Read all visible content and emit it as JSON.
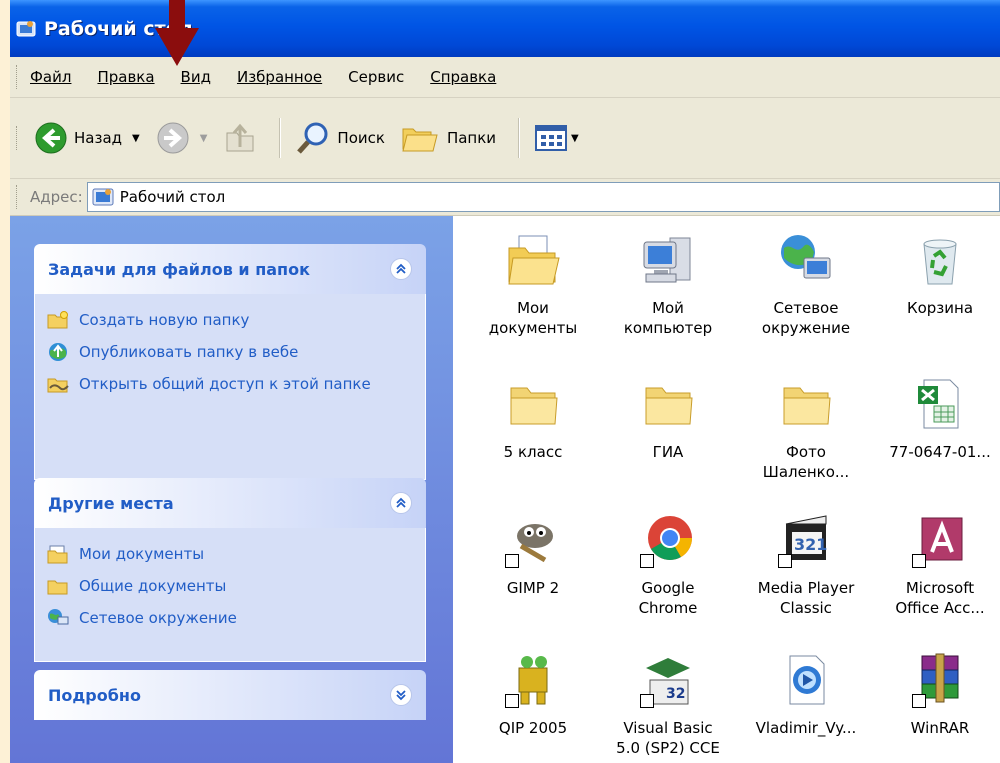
{
  "window": {
    "title": "Рабочий стол",
    "colors": {
      "titlebar": "#0055e5",
      "taskpane": "#6375d6",
      "link": "#215dc6",
      "desktop_bg": "#fdf1d6"
    }
  },
  "menu": [
    "Файл",
    "Правка",
    "Вид",
    "Избранное",
    "Сервис",
    "Справка"
  ],
  "menu_underline_index": [
    0,
    0,
    0,
    0,
    1,
    0
  ],
  "toolbar": {
    "back_label": "Назад",
    "search_label": "Поиск",
    "folders_label": "Папки",
    "icons": [
      "back-arrow-icon",
      "forward-arrow-icon",
      "up-folder-icon",
      "search-icon",
      "folders-icon",
      "views-icon"
    ]
  },
  "address": {
    "label_prefix": "Адрес",
    "label_suffix": ":",
    "value": "Рабочий стол"
  },
  "taskpane": {
    "tasks": {
      "header": "Задачи для файлов и папок",
      "links": [
        "Создать новую папку",
        "Опубликовать папку в вебе",
        "Открыть общий доступ к этой папке"
      ]
    },
    "other": {
      "header": "Другие места",
      "links": [
        "Мои документы",
        "Общие документы",
        "Сетевое окружение"
      ]
    },
    "details": {
      "header": "Подробно"
    }
  },
  "desktop_items": [
    {
      "name": "Мои\nдокументы",
      "icon": "my-documents-icon"
    },
    {
      "name": "Мой\nкомпьютер",
      "icon": "my-computer-icon"
    },
    {
      "name": "Сетевое\nокружение",
      "icon": "network-places-icon"
    },
    {
      "name": "Корзина",
      "icon": "recycle-bin-icon"
    },
    {
      "name": "5 класс",
      "icon": "folder-icon"
    },
    {
      "name": "ГИА",
      "icon": "folder-icon"
    },
    {
      "name": "Фото\nШаленко...",
      "icon": "folder-icon"
    },
    {
      "name": "77-0647-01...",
      "icon": "excel-file-icon"
    },
    {
      "name": "GIMP 2",
      "icon": "gimp-icon"
    },
    {
      "name": "Google\nChrome",
      "icon": "chrome-icon"
    },
    {
      "name": "Media Player\nClassic",
      "icon": "media-player-icon"
    },
    {
      "name": "Microsoft\nOffice Acc...",
      "icon": "access-icon"
    },
    {
      "name": "QIP 2005",
      "icon": "qip-icon"
    },
    {
      "name": "Visual Basic\n5.0 (SP2) CCE",
      "icon": "visual-basic-icon"
    },
    {
      "name": "Vladimir_Vy...",
      "icon": "media-file-icon"
    },
    {
      "name": "WinRAR",
      "icon": "winrar-icon"
    }
  ]
}
